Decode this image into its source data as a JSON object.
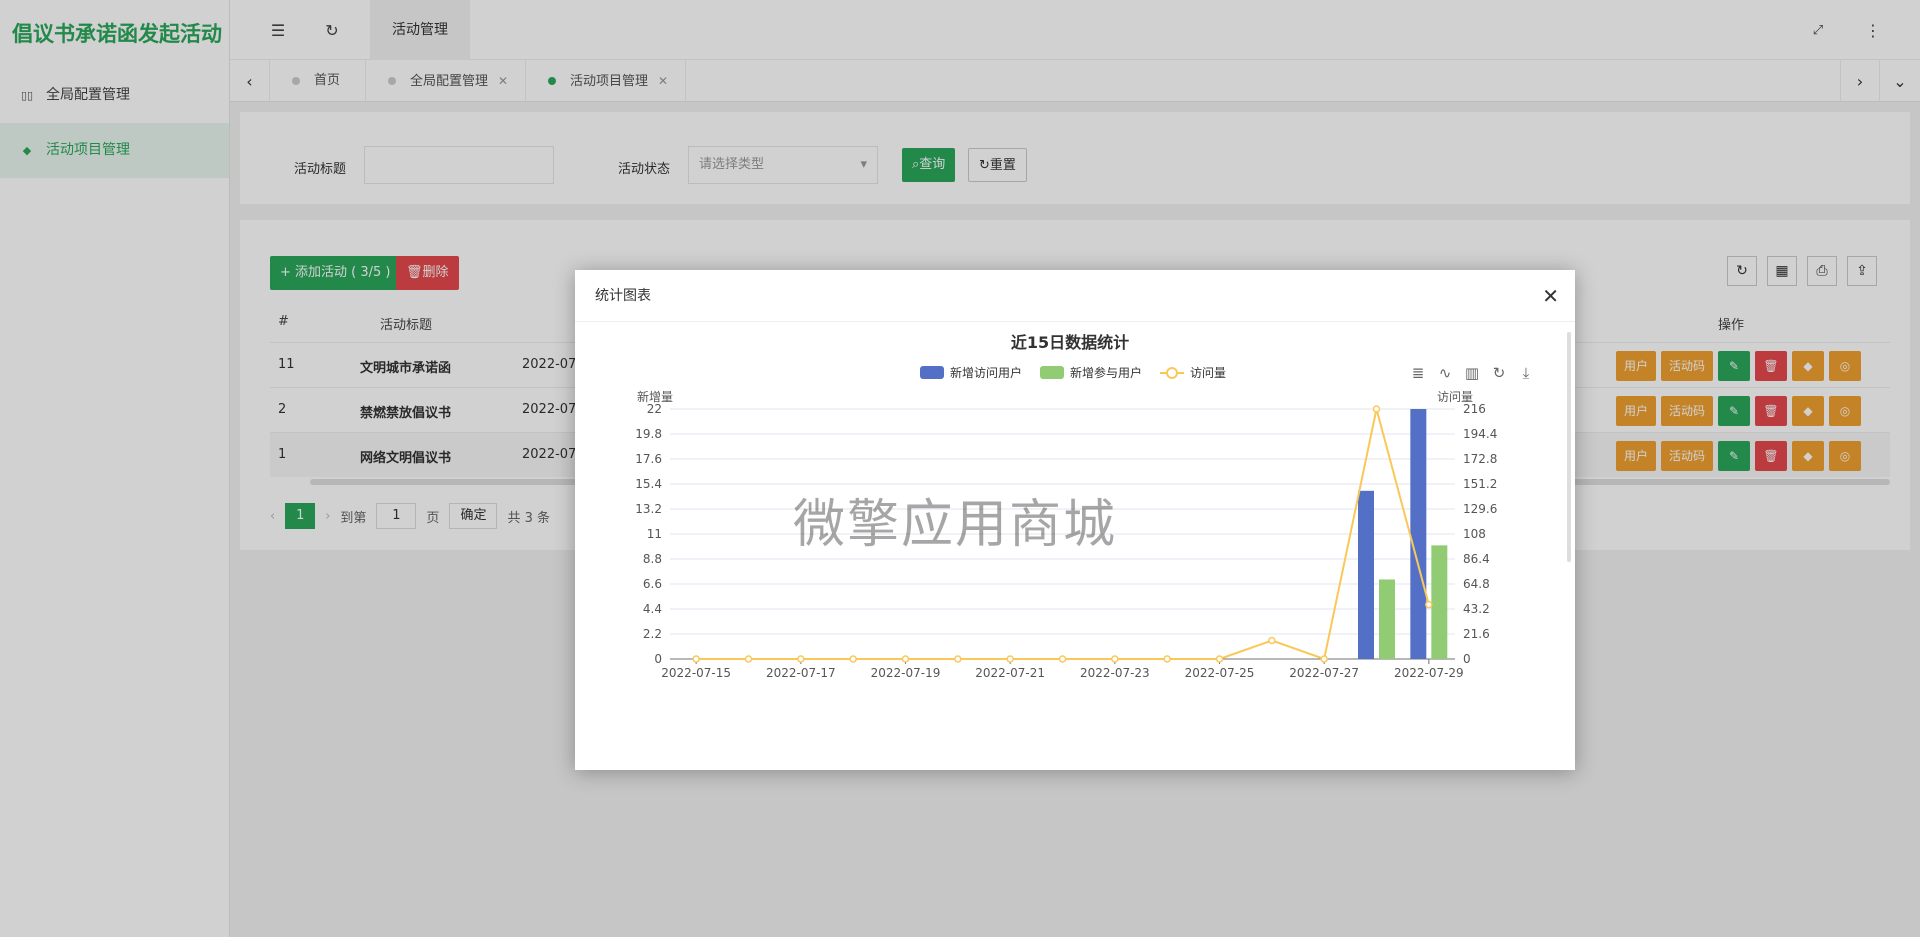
{
  "app": {
    "title": "倡议书承诺函发起活动"
  },
  "sidebar": {
    "items": [
      {
        "label": "全局配置管理",
        "icon": "settings-icon"
      },
      {
        "label": "活动项目管理",
        "icon": "layers-icon"
      }
    ]
  },
  "header": {
    "menu_tab": "活动管理"
  },
  "tabs": [
    {
      "label": "首页"
    },
    {
      "label": "全局配置管理"
    },
    {
      "label": "活动项目管理"
    }
  ],
  "search": {
    "title_label": "活动标题",
    "title_value": "",
    "status_label": "活动状态",
    "status_placeholder": "请选择类型",
    "query_label": "查询",
    "reset_label": "重置"
  },
  "table": {
    "add_label": "+ 添加活动 ( 3/5 )",
    "delete_label": "删除",
    "headers": {
      "index": "#",
      "title": "活动标题",
      "ops": "操作"
    },
    "rows": [
      {
        "id": "11",
        "title": "文明城市承诺函",
        "date": "2022-07-"
      },
      {
        "id": "2",
        "title": "禁燃禁放倡议书",
        "date": "2022-07-"
      },
      {
        "id": "1",
        "title": "网络文明倡议书",
        "date": "2022-07-"
      }
    ],
    "op_user": "用户",
    "op_code": "活动码"
  },
  "pager": {
    "current": "1",
    "goto_label": "到第",
    "goto_value": "1",
    "page_label": "页",
    "confirm_label": "确定",
    "total_label": "共 3 条"
  },
  "modal": {
    "title": "统计图表",
    "watermark": "微擎应用商城"
  },
  "chart_data": {
    "type": "bar",
    "title": "近15日数据统计",
    "categories": [
      "2022-07-15",
      "2022-07-16",
      "2022-07-17",
      "2022-07-18",
      "2022-07-19",
      "2022-07-20",
      "2022-07-21",
      "2022-07-22",
      "2022-07-23",
      "2022-07-24",
      "2022-07-25",
      "2022-07-26",
      "2022-07-27",
      "2022-07-28",
      "2022-07-29"
    ],
    "x_tick_labels": [
      "2022-07-15",
      "2022-07-17",
      "2022-07-19",
      "2022-07-21",
      "2022-07-23",
      "2022-07-25",
      "2022-07-27",
      "2022-07-29"
    ],
    "ylabel": "新增量",
    "y2label": "访问量",
    "ylim": [
      0,
      22
    ],
    "y2lim": [
      0,
      216
    ],
    "y_ticks": [
      "0",
      "2.2",
      "4.4",
      "6.6",
      "8.8",
      "11",
      "13.2",
      "15.4",
      "17.6",
      "19.8",
      "22"
    ],
    "y2_ticks": [
      "0",
      "21.6",
      "43.2",
      "64.8",
      "86.4",
      "108",
      "129.6",
      "151.2",
      "172.8",
      "194.4",
      "216"
    ],
    "legend_position": "top",
    "grid": true,
    "series": [
      {
        "name": "新增访问用户",
        "type": "bar",
        "axis": "left",
        "color": "#5470c6",
        "values": [
          0,
          0,
          0,
          0,
          0,
          0,
          0,
          0,
          0,
          0,
          0,
          0,
          0,
          14.8,
          22
        ]
      },
      {
        "name": "新增参与用户",
        "type": "bar",
        "axis": "left",
        "color": "#91cc75",
        "values": [
          0,
          0,
          0,
          0,
          0,
          0,
          0,
          0,
          0,
          0,
          0,
          0,
          0,
          7,
          10
        ]
      },
      {
        "name": "访问量",
        "type": "line",
        "axis": "right",
        "color": "#fac858",
        "values": [
          0,
          0,
          0,
          0,
          0,
          0,
          0,
          0,
          0,
          0,
          0,
          16,
          0,
          216,
          47
        ]
      }
    ]
  },
  "colors": {
    "accent": "#2aa85b",
    "danger": "#e5484d",
    "warning": "#f0a030"
  }
}
